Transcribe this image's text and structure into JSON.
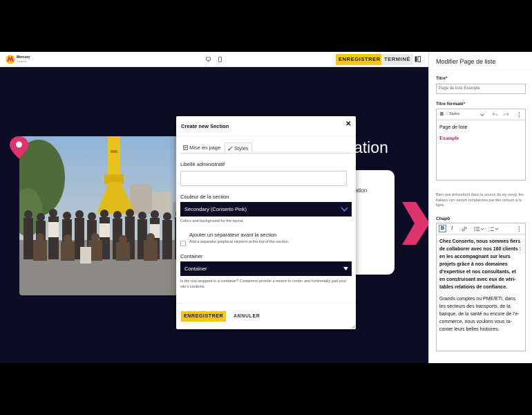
{
  "topbar": {
    "logo_name": "Mercury",
    "logo_sub": "Conserto",
    "save_label": "ENREGISTRER",
    "done_label": "TERMINÉ",
    "desktop_icon": "desktop-icon",
    "mobile_icon": "mobile-icon",
    "panel_icon": "panel-toggle-icon"
  },
  "canvas": {
    "heading_tail": "ation",
    "card_text": "ation",
    "brand_pink": "#e0336e",
    "dark_bg": "#0c0c24"
  },
  "modal": {
    "title": "Create new Section",
    "close_glyph": "✕",
    "tabs": [
      {
        "label": "Mise en page",
        "icon": "layout-icon"
      },
      {
        "label": "Styles",
        "icon": "brush-icon"
      }
    ],
    "admin_label": "Libellé administratif",
    "admin_value": "",
    "color_label": "Couleur de la section",
    "color_value": "Secondary (Conserto Pink)",
    "color_help": "Colors and background for the layout.",
    "separator_label": "Ajouter un séparateur avant la section",
    "separator_help": "Add a separator graphical element at the top of the section.",
    "container_label": "Container",
    "container_value": "Container",
    "container_help": "Is the row wrapped in a container? Containers provide a means to center and horizontally pad your site's contents.",
    "save_label": "ENREGISTRER",
    "cancel_label": "ANNULER"
  },
  "side": {
    "title": "Modifier Page de liste",
    "titre_label": "Titre",
    "titre_value": "Page de liste Example",
    "formatted_label": "Titre formaté",
    "styles_label": "Styles",
    "formatted_line1": "Page de liste",
    "formatted_line2": "Example",
    "help_text": "Bien que présentent dans la source du wy-swyg, les balises <p> seront remplacées par des retours à la ligne.",
    "chapo_label": "Chapô",
    "chapo_bold": "Chez Conserto, nous sommes fiers de collaborer avec nos 160 clients :",
    "chapo_bold2": "en les accompagnant sur leurs projets grâce à nos domaines d’expertise et nos consultants, et en construisant avec eux de véri-tables relations de confiance.",
    "chapo_normal": "Grands comptes ou PME/ETI, dans les secteurs des transports, de la banque, de la santé ou encore de l’e-commerce, nous voulons vous ra-conter leurs belles histoires."
  }
}
